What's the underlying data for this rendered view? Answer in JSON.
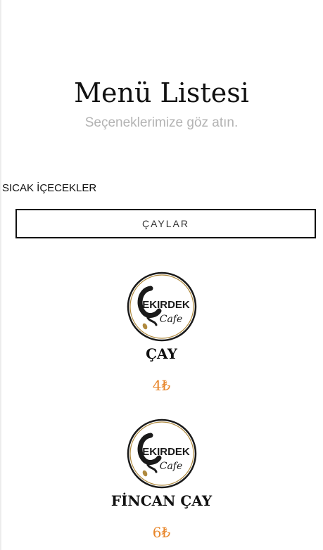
{
  "header": {
    "title": "Menü Listesi",
    "subtitle": "Seçeneklerimize göz atın."
  },
  "section": {
    "heading": "SICAK İÇECEKLER"
  },
  "category_tab": {
    "label": "ÇAYLAR"
  },
  "logo": {
    "brand_main": "EKIRDEK",
    "brand_script": "Cafe",
    "accent_color": "#b08a3e",
    "ink_color": "#1a1a1a"
  },
  "items": [
    {
      "name": "ÇAY",
      "price": "4₺"
    },
    {
      "name": "FİNCAN ÇAY",
      "price": "6₺"
    }
  ],
  "colors": {
    "price": "#e8862a",
    "subtitle": "#b3b3b3"
  }
}
